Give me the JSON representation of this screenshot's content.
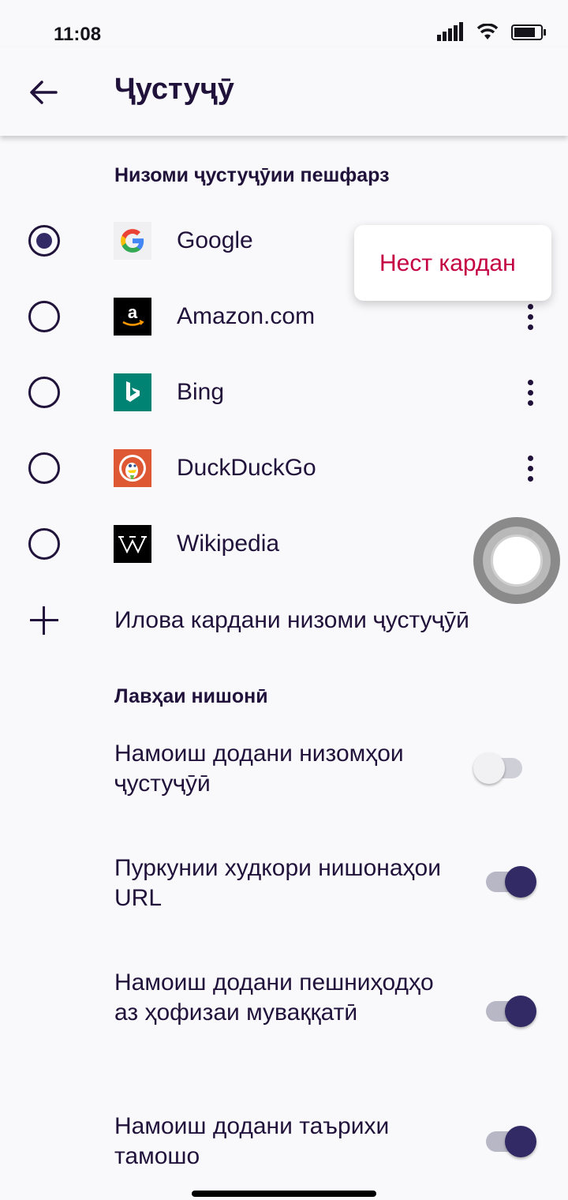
{
  "status_bar": {
    "time": "11:08"
  },
  "toolbar": {
    "title": "Ҷустуҷӯ",
    "back_icon": "back-arrow-icon"
  },
  "default_search": {
    "header": "Низоми ҷустуҷӯии пешфарз",
    "engines": [
      {
        "label": "Google",
        "icon": "google-logo-icon",
        "selected": true
      },
      {
        "label": "Amazon.com",
        "icon": "amazon-logo-icon",
        "selected": false
      },
      {
        "label": "Bing",
        "icon": "bing-logo-icon",
        "selected": false
      },
      {
        "label": "DuckDuckGo",
        "icon": "duckduckgo-logo-icon",
        "selected": false
      },
      {
        "label": "Wikipedia",
        "icon": "wikipedia-logo-icon",
        "selected": false
      }
    ],
    "add_label": "Илова кардани низоми ҷустуҷӯӣ"
  },
  "address_bar": {
    "header": "Лавҳаи нишонӣ",
    "settings": [
      {
        "label": "Намоиш додани низомҳои ҷустуҷӯӣ",
        "enabled": false
      },
      {
        "label": "Пуркунии худкори нишонаҳои URL",
        "enabled": true
      },
      {
        "label": "Намоиш додани пешниҳодҳо аз ҳофизаи муваққатӣ",
        "enabled": true
      },
      {
        "label": "Намоиш додани таърихи тамошо",
        "enabled": true
      }
    ]
  },
  "popup_menu": {
    "delete_label": "Нест кардан"
  },
  "colors": {
    "accent": "#312a65",
    "text": "#20123a",
    "danger": "#c50042"
  }
}
